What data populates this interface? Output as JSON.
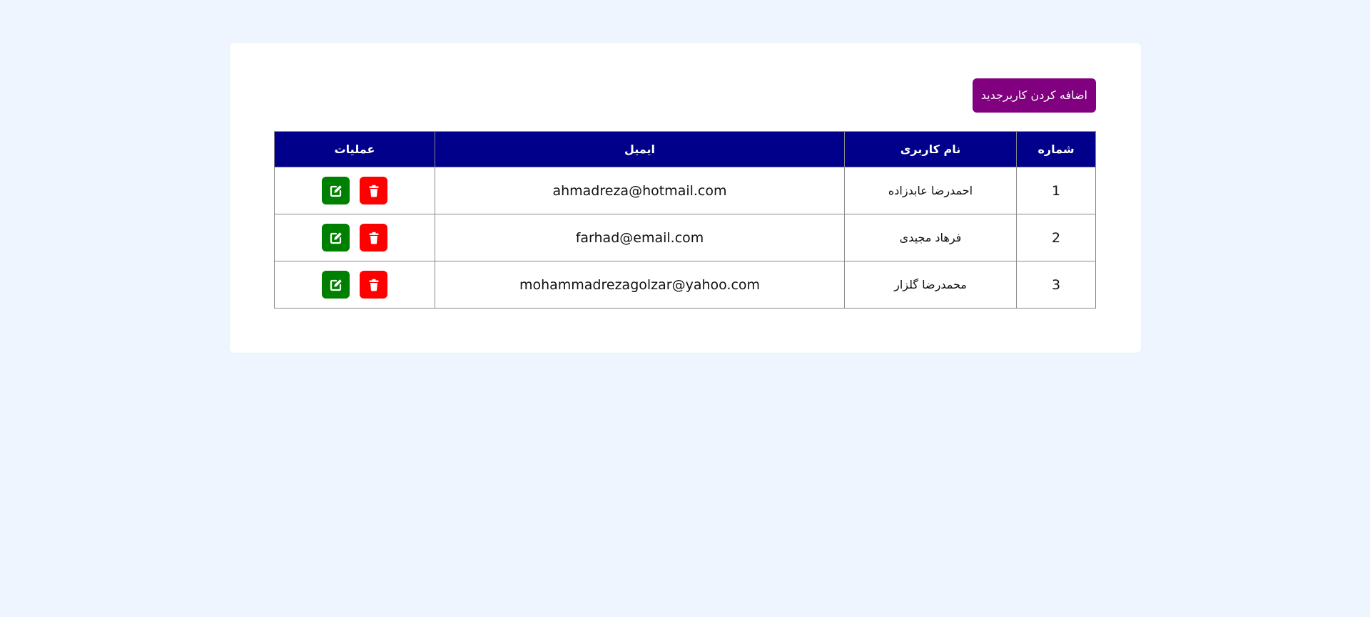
{
  "toolbar": {
    "add_user_label": "اضافه کردن کاربرجدید"
  },
  "table": {
    "headers": {
      "number": "شماره",
      "username": "نام کاربری",
      "email": "ایمیل",
      "actions": "عملیات"
    },
    "rows": [
      {
        "number": "1",
        "username": "احمدرضا عابدزاده",
        "email": "ahmadreza@hotmail.com"
      },
      {
        "number": "2",
        "username": "فرهاد مجیدی",
        "email": "farhad@email.com"
      },
      {
        "number": "3",
        "username": "محمدرضا گلزار",
        "email": "mohammadrezagolzar@yahoo.com"
      }
    ]
  },
  "icons": {
    "delete": "trash-icon",
    "edit": "edit-icon"
  },
  "colors": {
    "background": "#eef5fe",
    "card": "#ffffff",
    "add_button": "#800080",
    "header": "#00008b",
    "delete_button": "#ff0000",
    "edit_button": "#008000"
  }
}
